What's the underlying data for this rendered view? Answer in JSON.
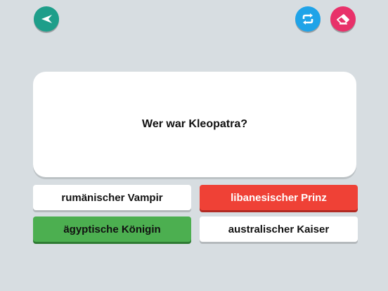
{
  "icons": {
    "back": "back-arrow-icon",
    "shuffle": "repeat-icon",
    "erase": "eraser-icon"
  },
  "colors": {
    "background": "#d7dde1",
    "back_button": "#1e9e8a",
    "shuffle_button": "#1fa3e8",
    "erase_button": "#e8316a",
    "wrong": "#ef4136",
    "correct": "#4caf50",
    "card": "#ffffff"
  },
  "question": {
    "text": "Wer war Kleopatra?"
  },
  "answers": [
    {
      "label": "rumänischer Vampir",
      "state": "neutral"
    },
    {
      "label": "libanesischer Prinz",
      "state": "wrong"
    },
    {
      "label": "ägyptische Königin",
      "state": "correct"
    },
    {
      "label": "australischer Kaiser",
      "state": "neutral"
    }
  ]
}
